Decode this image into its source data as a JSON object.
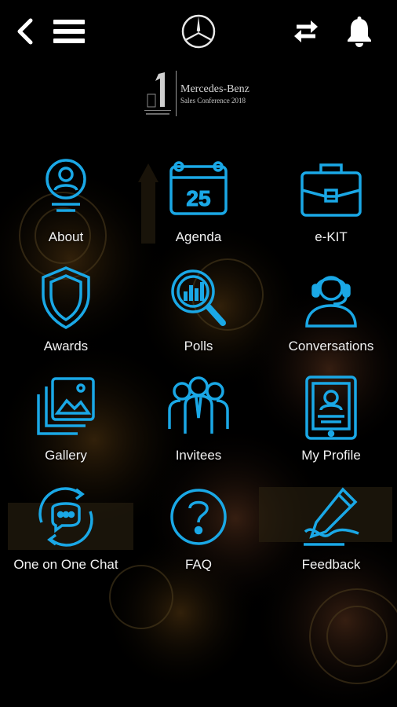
{
  "colors": {
    "accent": "#1aa8e6",
    "background": "#000000",
    "label": "#f2f2f2"
  },
  "header": {
    "back_icon": "chevron-left-icon",
    "menu_icon": "hamburger-menu-icon",
    "brand_icon": "mercedes-star-icon",
    "sync_icon": "sync-arrows-icon",
    "notification_icon": "bell-icon"
  },
  "logo": {
    "title": "Mercedes-Benz",
    "subtitle": "Sales Conference 2018"
  },
  "menu": [
    {
      "label": "About",
      "icon": "user-profile-icon"
    },
    {
      "label": "Agenda",
      "icon": "calendar-icon",
      "badge": "25"
    },
    {
      "label": "e-KIT",
      "icon": "briefcase-icon"
    },
    {
      "label": "Awards",
      "icon": "shield-icon"
    },
    {
      "label": "Polls",
      "icon": "chart-magnifier-icon"
    },
    {
      "label": "Conversations",
      "icon": "headset-agent-icon"
    },
    {
      "label": "Gallery",
      "icon": "photo-stack-icon"
    },
    {
      "label": "Invitees",
      "icon": "people-group-icon"
    },
    {
      "label": "My Profile",
      "icon": "tablet-profile-icon"
    },
    {
      "label": "One on One Chat",
      "icon": "chat-bubble-cycle-icon"
    },
    {
      "label": "FAQ",
      "icon": "question-circle-icon"
    },
    {
      "label": "Feedback",
      "icon": "pen-writing-icon"
    }
  ]
}
